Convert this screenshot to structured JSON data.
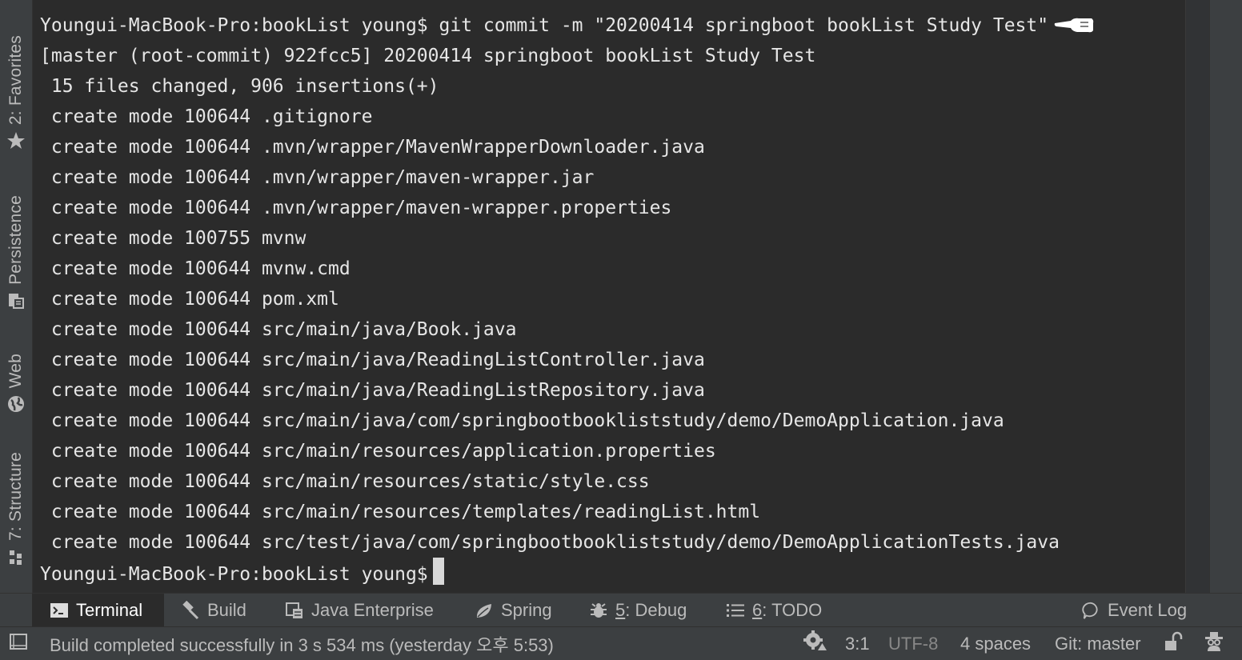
{
  "sidebar": {
    "favorites_label": "2: Favorites",
    "persistence_label": "Persistence",
    "web_label": "Web",
    "structure_label": "7: Structure"
  },
  "terminal": {
    "command_line": "Youngui-MacBook-Pro:bookList young$ git commit -m \"20200414 springboot bookList Study Test\"",
    "output_lines": [
      "[master (root-commit) 922fcc5] 20200414 springboot bookList Study Test",
      " 15 files changed, 906 insertions(+)",
      " create mode 100644 .gitignore",
      " create mode 100644 .mvn/wrapper/MavenWrapperDownloader.java",
      " create mode 100644 .mvn/wrapper/maven-wrapper.jar",
      " create mode 100644 .mvn/wrapper/maven-wrapper.properties",
      " create mode 100755 mvnw",
      " create mode 100644 mvnw.cmd",
      " create mode 100644 pom.xml",
      " create mode 100644 src/main/java/Book.java",
      " create mode 100644 src/main/java/ReadingListController.java",
      " create mode 100644 src/main/java/ReadingListRepository.java",
      " create mode 100644 src/main/java/com/springbootbookliststudy/demo/DemoApplication.java",
      " create mode 100644 src/main/resources/application.properties",
      " create mode 100644 src/main/resources/static/style.css",
      " create mode 100644 src/main/resources/templates/readingList.html",
      " create mode 100644 src/test/java/com/springbootbookliststudy/demo/DemoApplicationTests.java"
    ],
    "prompt": "Youngui-MacBook-Pro:bookList young$"
  },
  "tool_tabs": {
    "terminal": "Terminal",
    "build": "Build",
    "java_enterprise": "Java Enterprise",
    "spring": "Spring",
    "debug_num": "5",
    "debug_label": ": Debug",
    "todo_num": "6",
    "todo_label": ": TODO",
    "event_log": "Event Log"
  },
  "status": {
    "message": "Build completed successfully in 3 s 534 ms (yesterday 오후 5:53)",
    "position": "3:1",
    "encoding": "UTF-8",
    "indent": "4 spaces",
    "vcs": "Git: master"
  },
  "icons": {
    "favorites": "star-icon",
    "persistence": "persistence-icon",
    "web": "globe-icon",
    "structure": "structure-icon",
    "terminal": "terminal-icon",
    "build": "hammer-icon",
    "java_enterprise": "java-enterprise-icon",
    "spring": "spring-leaf-icon",
    "debug": "bug-icon",
    "todo": "todo-list-icon",
    "event_log": "speech-bubble-icon",
    "hide_panels": "square-icon",
    "event": "gear-icon",
    "lock": "unlock-icon",
    "inspector": "hector-icon"
  },
  "colors": {
    "background": "#2b2b2b",
    "panel": "#3c3f41",
    "text": "#bbbbbb",
    "terminal_text": "#e6e6e6"
  }
}
